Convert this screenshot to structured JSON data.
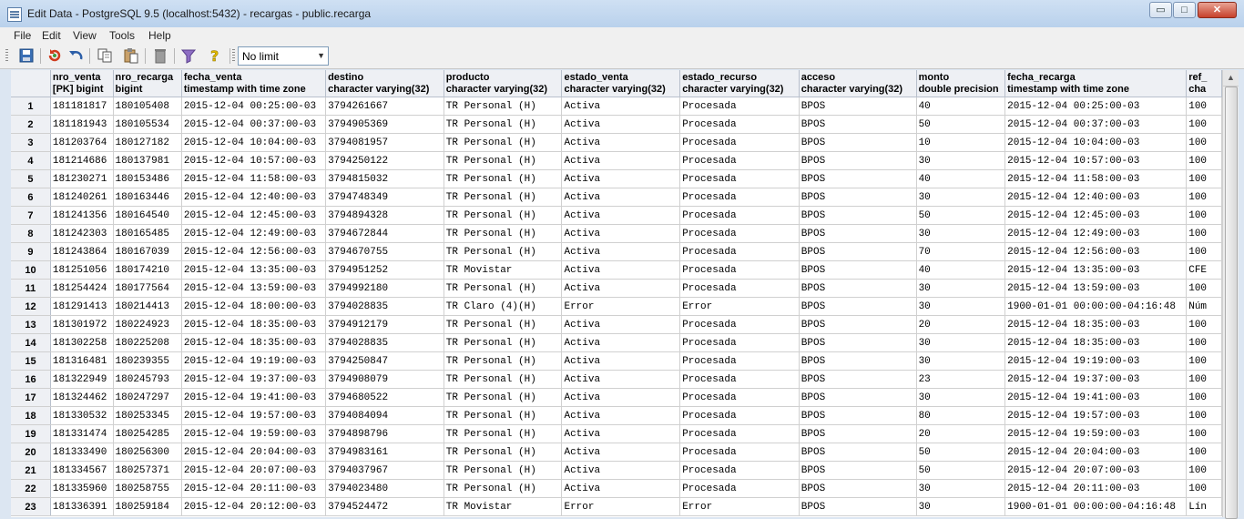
{
  "window": {
    "title": "Edit Data - PostgreSQL 9.5 (localhost:5432) - recargas - public.recarga",
    "min_glyph": "▭",
    "max_glyph": "□",
    "close_glyph": "✕"
  },
  "menu": [
    "File",
    "Edit",
    "View",
    "Tools",
    "Help"
  ],
  "toolbar": {
    "icons": [
      "save-icon",
      "refresh-icon",
      "undo-icon",
      "copy-icon",
      "paste-icon",
      "delete-icon",
      "filter-icon",
      "help-icon"
    ],
    "limit": "No limit"
  },
  "grid": {
    "columns": [
      {
        "name": "nro_venta",
        "type": "[PK] bigint"
      },
      {
        "name": "nro_recarga",
        "type": "bigint"
      },
      {
        "name": "fecha_venta",
        "type": "timestamp with time zone"
      },
      {
        "name": "destino",
        "type": "character varying(32)"
      },
      {
        "name": "producto",
        "type": "character varying(32)"
      },
      {
        "name": "estado_venta",
        "type": "character varying(32)"
      },
      {
        "name": "estado_recurso",
        "type": "character varying(32)"
      },
      {
        "name": "acceso",
        "type": "character varying(32)"
      },
      {
        "name": "monto",
        "type": "double precision"
      },
      {
        "name": "fecha_recarga",
        "type": "timestamp with time zone"
      },
      {
        "name": "ref_",
        "type": "cha"
      }
    ],
    "rows": [
      [
        "1",
        "181181817",
        "180105408",
        "2015-12-04 00:25:00-03",
        "3794261667",
        "TR Personal (H)",
        "Activa",
        "Procesada",
        "BPOS",
        "40",
        "2015-12-04 00:25:00-03",
        "100"
      ],
      [
        "2",
        "181181943",
        "180105534",
        "2015-12-04 00:37:00-03",
        "3794905369",
        "TR Personal (H)",
        "Activa",
        "Procesada",
        "BPOS",
        "50",
        "2015-12-04 00:37:00-03",
        "100"
      ],
      [
        "3",
        "181203764",
        "180127182",
        "2015-12-04 10:04:00-03",
        "3794081957",
        "TR Personal (H)",
        "Activa",
        "Procesada",
        "BPOS",
        "10",
        "2015-12-04 10:04:00-03",
        "100"
      ],
      [
        "4",
        "181214686",
        "180137981",
        "2015-12-04 10:57:00-03",
        "3794250122",
        "TR Personal (H)",
        "Activa",
        "Procesada",
        "BPOS",
        "30",
        "2015-12-04 10:57:00-03",
        "100"
      ],
      [
        "5",
        "181230271",
        "180153486",
        "2015-12-04 11:58:00-03",
        "3794815032",
        "TR Personal (H)",
        "Activa",
        "Procesada",
        "BPOS",
        "40",
        "2015-12-04 11:58:00-03",
        "100"
      ],
      [
        "6",
        "181240261",
        "180163446",
        "2015-12-04 12:40:00-03",
        "3794748349",
        "TR Personal (H)",
        "Activa",
        "Procesada",
        "BPOS",
        "30",
        "2015-12-04 12:40:00-03",
        "100"
      ],
      [
        "7",
        "181241356",
        "180164540",
        "2015-12-04 12:45:00-03",
        "3794894328",
        "TR Personal (H)",
        "Activa",
        "Procesada",
        "BPOS",
        "50",
        "2015-12-04 12:45:00-03",
        "100"
      ],
      [
        "8",
        "181242303",
        "180165485",
        "2015-12-04 12:49:00-03",
        "3794672844",
        "TR Personal (H)",
        "Activa",
        "Procesada",
        "BPOS",
        "30",
        "2015-12-04 12:49:00-03",
        "100"
      ],
      [
        "9",
        "181243864",
        "180167039",
        "2015-12-04 12:56:00-03",
        "3794670755",
        "TR Personal (H)",
        "Activa",
        "Procesada",
        "BPOS",
        "70",
        "2015-12-04 12:56:00-03",
        "100"
      ],
      [
        "10",
        "181251056",
        "180174210",
        "2015-12-04 13:35:00-03",
        "3794951252",
        "TR Movistar",
        "Activa",
        "Procesada",
        "BPOS",
        "40",
        "2015-12-04 13:35:00-03",
        "CFE"
      ],
      [
        "11",
        "181254424",
        "180177564",
        "2015-12-04 13:59:00-03",
        "3794992180",
        "TR Personal (H)",
        "Activa",
        "Procesada",
        "BPOS",
        "30",
        "2015-12-04 13:59:00-03",
        "100"
      ],
      [
        "12",
        "181291413",
        "180214413",
        "2015-12-04 18:00:00-03",
        "3794028835",
        "TR Claro (4)(H)",
        "Error",
        "Error",
        "BPOS",
        "30",
        "1900-01-01 00:00:00-04:16:48",
        "Núm"
      ],
      [
        "13",
        "181301972",
        "180224923",
        "2015-12-04 18:35:00-03",
        "3794912179",
        "TR Personal (H)",
        "Activa",
        "Procesada",
        "BPOS",
        "20",
        "2015-12-04 18:35:00-03",
        "100"
      ],
      [
        "14",
        "181302258",
        "180225208",
        "2015-12-04 18:35:00-03",
        "3794028835",
        "TR Personal (H)",
        "Activa",
        "Procesada",
        "BPOS",
        "30",
        "2015-12-04 18:35:00-03",
        "100"
      ],
      [
        "15",
        "181316481",
        "180239355",
        "2015-12-04 19:19:00-03",
        "3794250847",
        "TR Personal (H)",
        "Activa",
        "Procesada",
        "BPOS",
        "30",
        "2015-12-04 19:19:00-03",
        "100"
      ],
      [
        "16",
        "181322949",
        "180245793",
        "2015-12-04 19:37:00-03",
        "3794908079",
        "TR Personal (H)",
        "Activa",
        "Procesada",
        "BPOS",
        "23",
        "2015-12-04 19:37:00-03",
        "100"
      ],
      [
        "17",
        "181324462",
        "180247297",
        "2015-12-04 19:41:00-03",
        "3794680522",
        "TR Personal (H)",
        "Activa",
        "Procesada",
        "BPOS",
        "30",
        "2015-12-04 19:41:00-03",
        "100"
      ],
      [
        "18",
        "181330532",
        "180253345",
        "2015-12-04 19:57:00-03",
        "3794084094",
        "TR Personal (H)",
        "Activa",
        "Procesada",
        "BPOS",
        "80",
        "2015-12-04 19:57:00-03",
        "100"
      ],
      [
        "19",
        "181331474",
        "180254285",
        "2015-12-04 19:59:00-03",
        "3794898796",
        "TR Personal (H)",
        "Activa",
        "Procesada",
        "BPOS",
        "20",
        "2015-12-04 19:59:00-03",
        "100"
      ],
      [
        "20",
        "181333490",
        "180256300",
        "2015-12-04 20:04:00-03",
        "3794983161",
        "TR Personal (H)",
        "Activa",
        "Procesada",
        "BPOS",
        "50",
        "2015-12-04 20:04:00-03",
        "100"
      ],
      [
        "21",
        "181334567",
        "180257371",
        "2015-12-04 20:07:00-03",
        "3794037967",
        "TR Personal (H)",
        "Activa",
        "Procesada",
        "BPOS",
        "50",
        "2015-12-04 20:07:00-03",
        "100"
      ],
      [
        "22",
        "181335960",
        "180258755",
        "2015-12-04 20:11:00-03",
        "3794023480",
        "TR Personal (H)",
        "Activa",
        "Procesada",
        "BPOS",
        "30",
        "2015-12-04 20:11:00-03",
        "100"
      ],
      [
        "23",
        "181336391",
        "180259184",
        "2015-12-04 20:12:00-03",
        "3794524472",
        "TR Movistar",
        "Error",
        "Error",
        "BPOS",
        "30",
        "1900-01-01 00:00:00-04:16:48",
        "Lín"
      ]
    ]
  }
}
